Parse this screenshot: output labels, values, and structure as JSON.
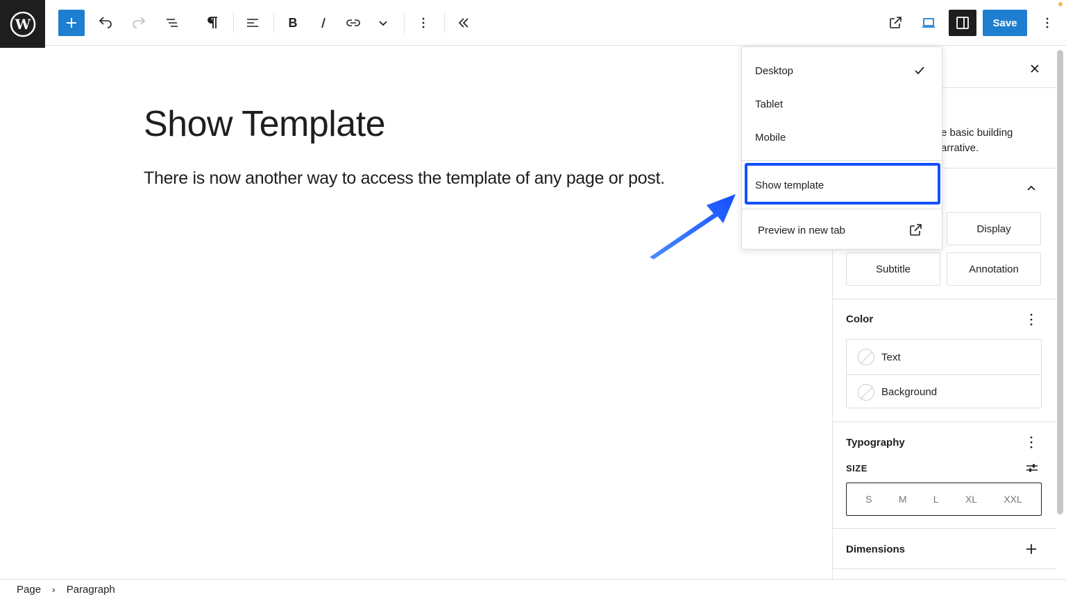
{
  "toolbar": {
    "save_label": "Save"
  },
  "canvas": {
    "title": "Show Template",
    "paragraph": "There is now another way to access the template of any page or post."
  },
  "menu": {
    "items": [
      {
        "label": "Desktop",
        "checked": true
      },
      {
        "label": "Tablet",
        "checked": false
      },
      {
        "label": "Mobile",
        "checked": false
      }
    ],
    "show_template": "Show template",
    "preview_new_tab": "Preview in new tab"
  },
  "sidebar": {
    "description_line1": "e basic building",
    "description_line2": "arrative.",
    "styles": [
      "Display",
      "Subtitle",
      "Annotation"
    ],
    "color": {
      "title": "Color",
      "text": "Text",
      "background": "Background"
    },
    "typography": {
      "title": "Typography",
      "size_label": "SIZE",
      "sizes": [
        "S",
        "M",
        "L",
        "XL",
        "XXL"
      ]
    },
    "dimensions": {
      "title": "Dimensions"
    }
  },
  "breadcrumb": {
    "items": [
      "Page",
      "Paragraph"
    ]
  },
  "colors": {
    "accent": "#1e7fd0",
    "highlight": "#1450ff",
    "dark": "#1e1e1e"
  }
}
